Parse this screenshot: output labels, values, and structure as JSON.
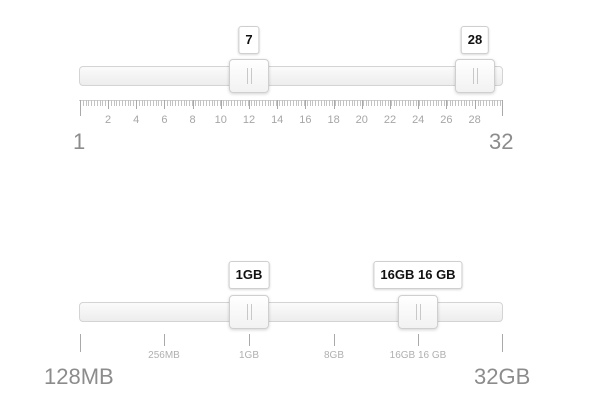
{
  "slider_cores": {
    "min_label": "1",
    "max_label": "32",
    "low_value": "7",
    "high_value": "28",
    "tick_labels": [
      "2",
      "4",
      "6",
      "8",
      "10",
      "12",
      "14",
      "16",
      "18",
      "20",
      "22",
      "24",
      "26",
      "28"
    ]
  },
  "slider_memory": {
    "min_label": "128MB",
    "max_label": "32GB",
    "low_value": "1GB",
    "high_value": "16GB 16 GB",
    "tick_labels": [
      "256MB",
      "1GB",
      "8GB",
      "16GB 16 GB"
    ]
  }
}
